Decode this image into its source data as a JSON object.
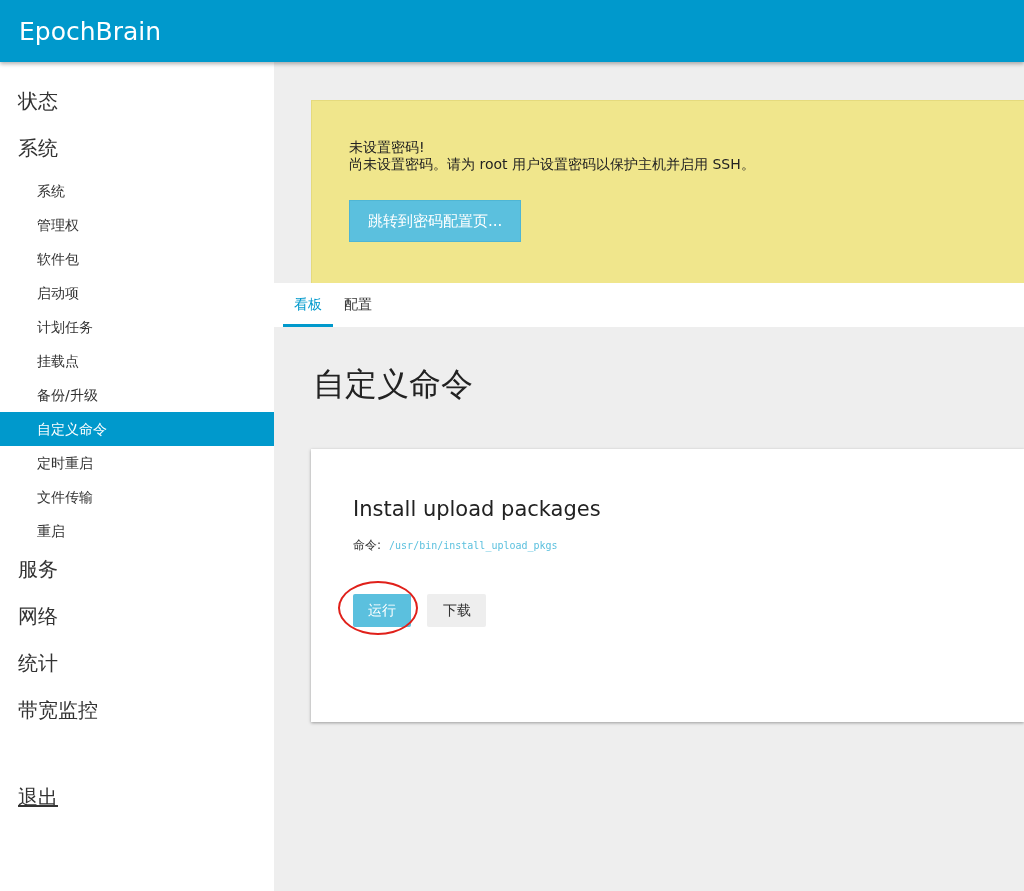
{
  "header": {
    "brand": "EpochBrain"
  },
  "sidebar": {
    "items": [
      {
        "label": "状态",
        "selected": false
      },
      {
        "label": "系统",
        "selected": false,
        "children": [
          {
            "label": "系统",
            "selected": false
          },
          {
            "label": "管理权",
            "selected": false
          },
          {
            "label": "软件包",
            "selected": false
          },
          {
            "label": "启动项",
            "selected": false
          },
          {
            "label": "计划任务",
            "selected": false
          },
          {
            "label": "挂载点",
            "selected": false
          },
          {
            "label": "备份/升级",
            "selected": false
          },
          {
            "label": "自定义命令",
            "selected": true
          },
          {
            "label": "定时重启",
            "selected": false
          },
          {
            "label": "文件传输",
            "selected": false
          },
          {
            "label": "重启",
            "selected": false
          }
        ]
      },
      {
        "label": "服务",
        "selected": false
      },
      {
        "label": "网络",
        "selected": false
      },
      {
        "label": "统计",
        "selected": false
      },
      {
        "label": "带宽监控",
        "selected": false
      }
    ],
    "logout": "退出"
  },
  "alert": {
    "title": "未设置密码!",
    "message": "尚未设置密码。请为 root 用户设置密码以保护主机并启用 SSH。",
    "button": "跳转到密码配置页..."
  },
  "tabs": [
    {
      "label": "看板",
      "selected": true
    },
    {
      "label": "配置",
      "selected": false
    }
  ],
  "page_title": "自定义命令",
  "commands": [
    {
      "title": "Install upload packages",
      "command_label": "命令:",
      "command": "/usr/bin/install_upload_pkgs",
      "run_button": "运行",
      "download_button": "下载",
      "run_circled": true
    }
  ]
}
